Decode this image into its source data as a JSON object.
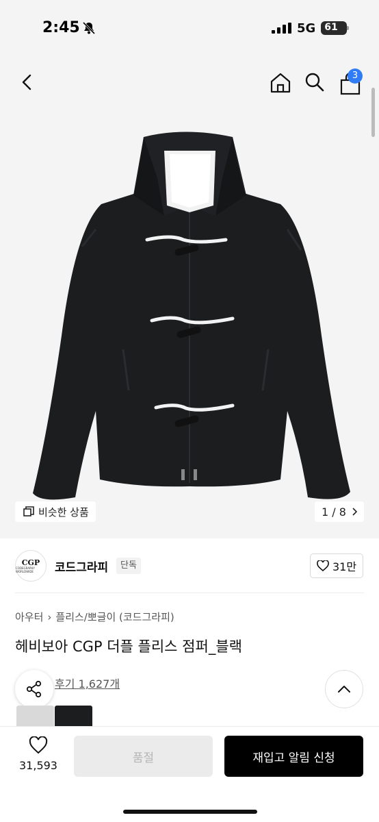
{
  "status_bar": {
    "time": "2:45",
    "network": "5G",
    "battery": "61"
  },
  "header": {
    "cart_count": "3"
  },
  "gallery": {
    "similar_label": "비슷한 상품",
    "pager": "1 / 8"
  },
  "brand": {
    "logo_text": "CGP",
    "logo_subtext": "CODEGRAPHY WORLDWIDE",
    "name": "코드그라피",
    "badge": "단독",
    "likes": "31만"
  },
  "product": {
    "breadcrumb": [
      "아우터",
      "플리스/뽀글이 (코드그라피)"
    ],
    "title": "헤비보아 CGP 더플 플리스 점퍼_블랙",
    "review_link": "후기 1,627개"
  },
  "bottom": {
    "wish_count": "31,593",
    "soldout_label": "품절",
    "restock_label": "재입고 알림 신청"
  },
  "colors": {
    "accent": "#2f7cf6",
    "primary_button": "#000000",
    "disabled_button": "#ebebeb",
    "background_gray": "#f4f4f4"
  }
}
